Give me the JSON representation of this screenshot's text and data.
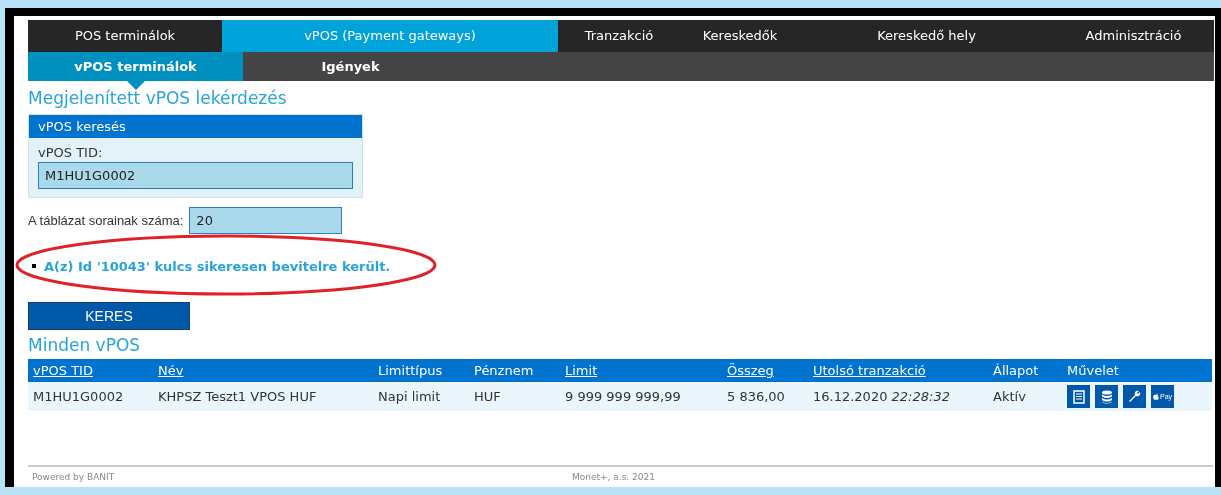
{
  "nav": {
    "tabs": [
      {
        "label": "POS terminálok",
        "selected": false
      },
      {
        "label": "vPOS (Payment gateways)",
        "selected": true
      },
      {
        "label": "Tranzakció",
        "selected": false
      },
      {
        "label": "Kereskedők",
        "selected": false
      },
      {
        "label": "Kereskedő hely",
        "selected": false
      },
      {
        "label": "Adminisztráció",
        "selected": false
      }
    ],
    "subtabs": [
      {
        "label": "vPOS terminálok",
        "selected": true
      },
      {
        "label": "Igények",
        "selected": false
      }
    ]
  },
  "page_title": "Megjelenített vPOS lekérdezés",
  "search_panel": {
    "title": "vPOS keresés",
    "field_label": "vPOS TID:",
    "field_value": "M1HU1G0002"
  },
  "rows_field": {
    "label": "A táblázat sorainak száma:",
    "value": "20"
  },
  "messages": [
    "A(z) Id '10043' kulcs sikeresen bevitelre került."
  ],
  "search_button": "KERES",
  "table": {
    "title": "Minden vPOS",
    "columns": [
      {
        "label": "vPOS TID",
        "sortable": true
      },
      {
        "label": "Név",
        "sortable": true
      },
      {
        "label": "Limittípus",
        "sortable": false
      },
      {
        "label": "Pénznem",
        "sortable": false
      },
      {
        "label": "Limit",
        "sortable": true
      },
      {
        "label": "Összeg",
        "sortable": true
      },
      {
        "label": "Utolsó tranzakció",
        "sortable": true
      },
      {
        "label": "Állapot",
        "sortable": false
      },
      {
        "label": "Művelet",
        "sortable": false
      }
    ],
    "rows": [
      {
        "tid": "M1HU1G0002",
        "name": "KHPSZ Teszt1 VPOS HUF",
        "limit_type": "Napi limit",
        "currency": "HUF",
        "limit": "9 999 999 999,99",
        "amount": "5 836,00",
        "last_date": "16.12.2020",
        "last_time": "22:28:32",
        "status": "Aktív",
        "actions": [
          {
            "kind": "document"
          },
          {
            "kind": "database"
          },
          {
            "kind": "wrench"
          },
          {
            "kind": "pay",
            "label": "Pay"
          }
        ]
      }
    ]
  },
  "footer": {
    "left": "Powered by BANIT",
    "center": "Monet+, a.s. 2021"
  }
}
